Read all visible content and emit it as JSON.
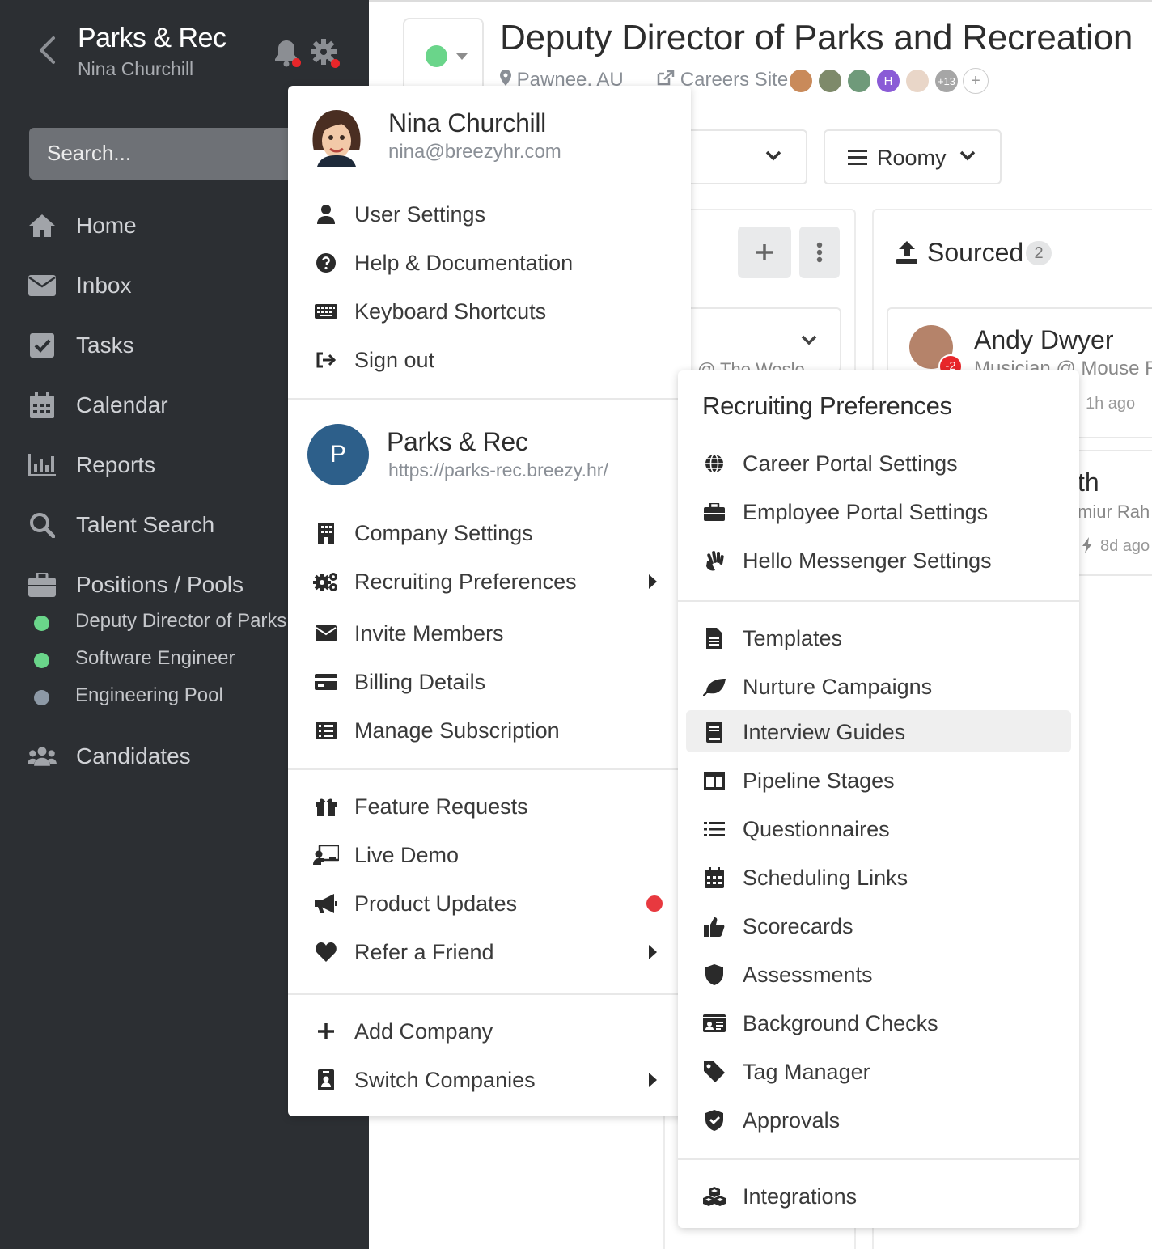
{
  "sidebar": {
    "company": "Parks & Rec",
    "user": "Nina Churchill",
    "search_placeholder": "Search...",
    "nav": [
      {
        "label": "Home",
        "icon": "home-icon"
      },
      {
        "label": "Inbox",
        "icon": "envelope-icon"
      },
      {
        "label": "Tasks",
        "icon": "checkbox-icon"
      },
      {
        "label": "Calendar",
        "icon": "calendar-icon"
      },
      {
        "label": "Reports",
        "icon": "bar-chart-icon"
      },
      {
        "label": "Talent Search",
        "icon": "search-icon"
      },
      {
        "label": "Positions / Pools",
        "icon": "briefcase-icon"
      }
    ],
    "positions": [
      {
        "label": "Deputy Director of Parks a",
        "color": "#6ad58a"
      },
      {
        "label": "Software Engineer",
        "color": "#6ad58a"
      },
      {
        "label": "Engineering Pool",
        "color": "#8d99a6"
      }
    ],
    "candidates": "Candidates"
  },
  "header": {
    "title": "Deputy Director of Parks and Recreation",
    "location": "Pawnee, AU",
    "careers": "Careers Site",
    "more_count": "+13",
    "add": "+",
    "view_mode": "Roomy"
  },
  "pipeline": {
    "stage_name": "Sourced",
    "stage_count": "2",
    "partial_text": "@ The Wesle",
    "candidate1": {
      "name": "Andy Dwyer",
      "subtitle": "Musician @ Mouse Ra",
      "time": "1h ago",
      "badge": "-2"
    },
    "candidate2": {
      "name_fragment": "th",
      "subtitle": "miur Rah",
      "time": "8d ago"
    }
  },
  "user_menu": {
    "name": "Nina Churchill",
    "email": "nina@breezyhr.com",
    "items": [
      "User Settings",
      "Help & Documentation",
      "Keyboard Shortcuts",
      "Sign out"
    ],
    "company_initial": "P",
    "company_name": "Parks & Rec",
    "company_url": "https://parks-rec.breezy.hr/",
    "company_items": [
      "Company Settings",
      "Recruiting Preferences",
      "Invite Members",
      "Billing Details",
      "Manage Subscription"
    ],
    "extra_items": [
      "Feature Requests",
      "Live Demo",
      "Product Updates",
      "Refer a Friend"
    ],
    "account_items": [
      "Add Company",
      "Switch Companies"
    ]
  },
  "submenu": {
    "title": "Recruiting Preferences",
    "group1": [
      "Career Portal Settings",
      "Employee Portal Settings",
      "Hello Messenger Settings"
    ],
    "group2": [
      "Templates",
      "Nurture Campaigns",
      "Interview Guides",
      "Pipeline Stages",
      "Questionnaires",
      "Scheduling Links",
      "Scorecards",
      "Assessments",
      "Background Checks",
      "Tag Manager",
      "Approvals"
    ],
    "group3": [
      "Integrations"
    ],
    "highlighted": "Interview Guides"
  },
  "colors": {
    "sidebar_bg": "#2c2f33",
    "active_green": "#6ad58a",
    "notify_red": "#e8262a",
    "company_blue": "#2d5f8a"
  }
}
